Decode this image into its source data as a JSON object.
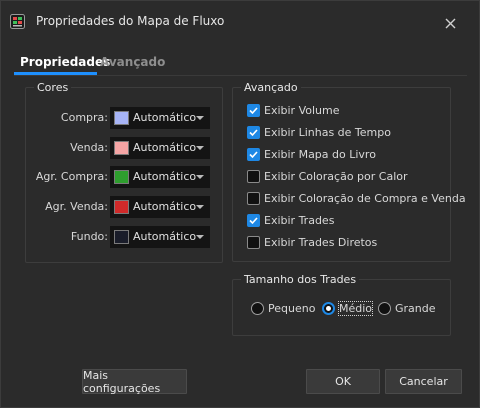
{
  "window": {
    "title": "Propriedades do Mapa de Fluxo"
  },
  "tabs": [
    {
      "label": "Propriedades",
      "active": true
    },
    {
      "label": "Avançado",
      "active": false
    }
  ],
  "cores": {
    "label": "Cores",
    "items": [
      {
        "label": "Compra:",
        "value": "Automático",
        "color": "#a7b4f5"
      },
      {
        "label": "Venda:",
        "value": "Automático",
        "color": "#f4a4a4"
      },
      {
        "label": "Agr. Compra:",
        "value": "Automático",
        "color": "#2e9e2e"
      },
      {
        "label": "Agr. Venda:",
        "value": "Automático",
        "color": "#d02a2a"
      },
      {
        "label": "Fundo:",
        "value": "Automático",
        "color": "#1a1d2a"
      }
    ]
  },
  "avancado": {
    "label": "Avançado",
    "options": [
      {
        "label": "Exibir Volume",
        "checked": true
      },
      {
        "label": "Exibir Linhas de Tempo",
        "checked": true
      },
      {
        "label": "Exibir Mapa do Livro",
        "checked": true
      },
      {
        "label": "Exibir Coloração por Calor",
        "checked": false
      },
      {
        "label": "Exibir Coloração de Compra e Venda",
        "checked": false
      },
      {
        "label": "Exibir Trades",
        "checked": true
      },
      {
        "label": "Exibir Trades Diretos",
        "checked": false
      }
    ]
  },
  "tamanho": {
    "label": "Tamanho dos Trades",
    "options": [
      {
        "label": "Pequeno",
        "selected": false
      },
      {
        "label": "Médio",
        "selected": true
      },
      {
        "label": "Grande",
        "selected": false
      }
    ]
  },
  "buttons": {
    "more": "Mais configurações",
    "ok": "OK",
    "cancel": "Cancelar"
  },
  "colors": {
    "accent": "#1e88e5",
    "background": "#2b2b2b"
  }
}
